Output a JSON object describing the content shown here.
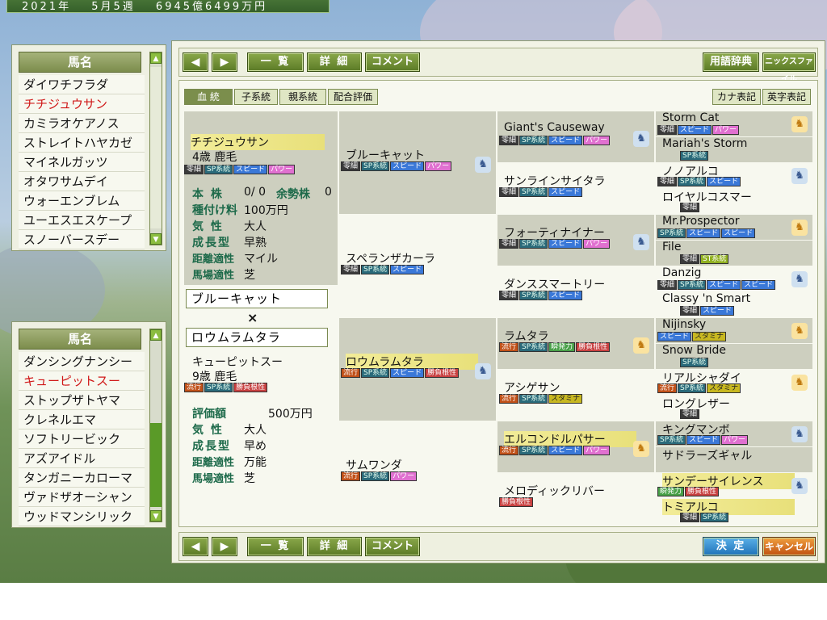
{
  "status": {
    "year": "2021年",
    "week": "5月5週",
    "money": "6945億6499万円"
  },
  "list1": {
    "header": "馬名",
    "items": [
      "ダイワチフラダ",
      "チチジュウサン",
      "カミラオケアノス",
      "ストレイトハヤカゼ",
      "マイネルガッツ",
      "オタワサムデイ",
      "ウォーエンブレム",
      "ユーエスエスケープ",
      "スノーバースデー"
    ],
    "selected": "チチジュウサン"
  },
  "list2": {
    "header": "馬名",
    "items": [
      "ダンシングナンシー",
      "キューピットスー",
      "ストップザトヤマ",
      "クレネルエマ",
      "ソフトリービック",
      "アズアイドル",
      "タンガニーカローマ",
      "ヴァドザオーシャン",
      "ウッドマンシリック"
    ],
    "selected": "キューピットスー"
  },
  "toolbar": {
    "prev": "◀",
    "next": "▶",
    "list": "一 覧",
    "detail": "詳 細",
    "comment": "コメント",
    "dictionary": "用語辞典",
    "nicks": "ニックスファイル",
    "confirm": "決 定",
    "cancel": "キャンセル"
  },
  "tabs": {
    "t1": "血 統",
    "t2": "子系統",
    "t3": "親系統",
    "t4": "配合評価",
    "kana": "カナ表記",
    "eng": "英字表記"
  },
  "sire": {
    "name": "チチジュウサン",
    "age_coat": "4歳 鹿毛",
    "badges": [
      "零細",
      "SP系統",
      "スピード",
      "パワー"
    ],
    "stud_label": "本 株",
    "stud_value": "0/ 0",
    "spare_label": "余勢株",
    "spare_value": "0",
    "fee_label": "種付け料",
    "fee_value": "100万円",
    "temper_label": "気 性",
    "temper_value": "大人",
    "growth_label": "成長型",
    "growth_value": "早熟",
    "dist_label": "距離適性",
    "dist_value": "マイル",
    "track_label": "馬場適性",
    "track_value": "芝"
  },
  "selection": {
    "sire_box": "ブルーキャット",
    "cross": "×",
    "dam_box": "ロウムラムタラ"
  },
  "dam": {
    "name": "キューピットスー",
    "age_coat": "9歳 鹿毛",
    "badges": [
      "流行",
      "SP系統",
      "勝負根性"
    ],
    "eval_label": "評価額",
    "eval_value": "500万円",
    "temper_label": "気 性",
    "temper_value": "大人",
    "growth_label": "成長型",
    "growth_value": "早め",
    "dist_label": "距離適性",
    "dist_value": "万能",
    "track_label": "馬場適性",
    "track_value": "芝"
  },
  "gen1": [
    {
      "name": "ブルーキャット",
      "badges": [
        "零細",
        "SP系統",
        "スピード",
        "パワー"
      ],
      "icon": "horse-blue-icon"
    },
    {
      "name": "スペランザカーラ",
      "badges": [
        "零細",
        "SP系統",
        "スピード"
      ]
    },
    {
      "name": "ロウムラムタラ",
      "badges": [
        "流行",
        "SP系統",
        "スピード",
        "勝負根性"
      ],
      "icon": "horse-blue-icon",
      "highlight": true
    },
    {
      "name": "サムワンダ",
      "badges": [
        "流行",
        "SP系統",
        "パワー"
      ]
    }
  ],
  "gen2": [
    {
      "name": "Giant's Causeway",
      "badges": [
        "零細",
        "SP系統",
        "スピード",
        "パワー"
      ],
      "icon": "horse-blue-icon"
    },
    {
      "name": "サンラインサイタラ",
      "badges": [
        "零細",
        "SP系統",
        "スピード"
      ]
    },
    {
      "name": "フォーティナイナー",
      "badges": [
        "零細",
        "SP系統",
        "スピード",
        "パワー"
      ],
      "icon": "horse-blue-icon"
    },
    {
      "name": "ダンススマートリー",
      "badges": [
        "零細",
        "SP系統",
        "スピード"
      ]
    },
    {
      "name": "ラムタラ",
      "badges": [
        "流行",
        "SP系統",
        "瞬発力",
        "勝負根性"
      ],
      "icon": "horse-gold-icon"
    },
    {
      "name": "アシゲサン",
      "badges": [
        "流行",
        "SP系統",
        "スタミナ"
      ]
    },
    {
      "name": "エルコンドルパサー",
      "badges": [
        "流行",
        "SP系統",
        "スピード",
        "パワー"
      ],
      "icon": "horse-gold-icon",
      "highlight": true
    },
    {
      "name": "メロディックリバー",
      "badges": [
        "勝負根性"
      ]
    }
  ],
  "gen3": [
    {
      "name": "Storm Cat",
      "badges": [
        "零細",
        "スピード",
        "パワー"
      ],
      "icon": "horse-gold-icon"
    },
    {
      "name": "Mariah's Storm",
      "badges": [
        "SP系統"
      ]
    },
    {
      "name": "ノノアルコ",
      "badges": [
        "零細",
        "SP系統",
        "スピード"
      ],
      "icon": "horse-blue-icon"
    },
    {
      "name": "ロイヤルコスマー",
      "badges": [
        "零細"
      ]
    },
    {
      "name": "Mr.Prospector",
      "badges": [
        "SP系統",
        "スピード",
        "スピード"
      ],
      "icon": "horse-gold-icon"
    },
    {
      "name": "File",
      "badges": [
        "零細",
        "ST系統"
      ]
    },
    {
      "name": "Danzig",
      "badges": [
        "零細",
        "SP系統",
        "スピード",
        "スピード"
      ],
      "icon": "horse-blue-icon"
    },
    {
      "name": "Classy 'n Smart",
      "badges": [
        "零細",
        "スピード"
      ]
    },
    {
      "name": "Nijinsky",
      "badges": [
        "スピード",
        "スタミナ"
      ],
      "icon": "horse-gold-icon"
    },
    {
      "name": "Snow Bride",
      "badges": [
        "SP系統"
      ]
    },
    {
      "name": "リアルシャダイ",
      "badges": [
        "流行",
        "SP系統",
        "スタミナ"
      ],
      "icon": "horse-gold-icon"
    },
    {
      "name": "ロングレザー",
      "badges": [
        "零細"
      ]
    },
    {
      "name": "キングマンボ",
      "badges": [
        "SP系統",
        "スピード",
        "パワー"
      ],
      "icon": "horse-blue-icon"
    },
    {
      "name": "サドラーズギャル",
      "badges": []
    },
    {
      "name": "サンデーサイレンス",
      "badges": [
        "瞬発力",
        "勝負根性"
      ],
      "icon": "horse-blue-icon",
      "highlight": true
    },
    {
      "name": "トミアルコ",
      "badges": [
        "零細",
        "SP系統"
      ],
      "highlight": true
    }
  ]
}
